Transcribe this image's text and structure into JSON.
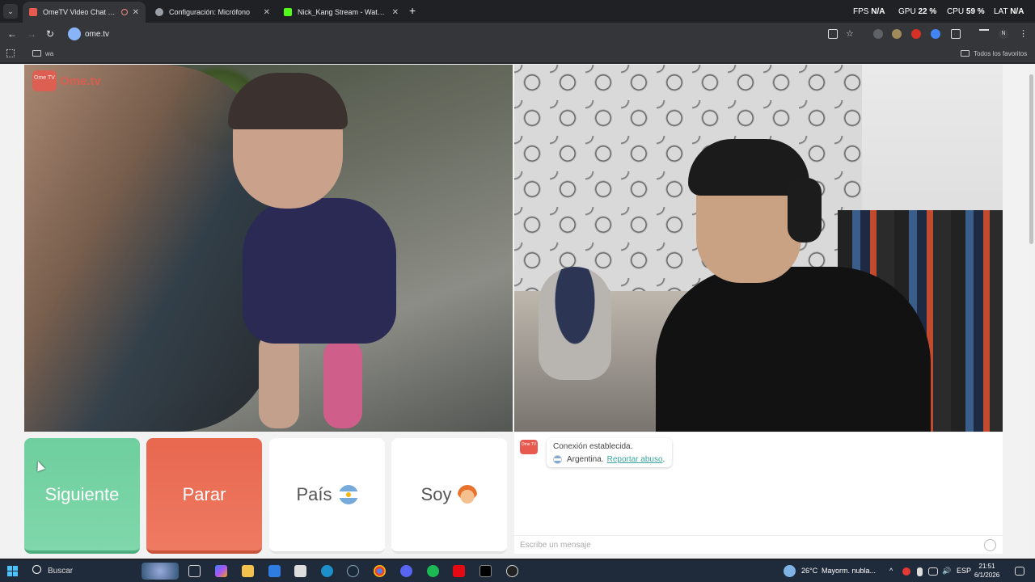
{
  "browser": {
    "tabs": [
      {
        "title": "OmeTV Video Chat — Ome",
        "active": true,
        "favicon_color": "#e85a4f"
      },
      {
        "title": "Configuración: Micrófono",
        "active": false,
        "favicon_color": "#9aa0a6"
      },
      {
        "title": "Nick_Kang Stream - Watch Live",
        "active": false,
        "favicon_color": "#53fc18"
      }
    ],
    "new_tab": "+",
    "perf": {
      "fps_label": "FPS",
      "fps_value": "N/A",
      "gpu_label": "GPU",
      "gpu_value": "22 %",
      "cpu_label": "CPU",
      "cpu_value": "59 %",
      "lat_label": "LAT",
      "lat_value": "N/A"
    },
    "url": "ome.tv",
    "bookmarks": {
      "folder": "wa",
      "all": "Todos los favoritos"
    }
  },
  "ometv": {
    "logo_box": "Ome TV",
    "logo_text": "Ome.tv",
    "buttons": {
      "next": "Siguiente",
      "stop": "Parar",
      "country": "País",
      "gender": "Soy"
    },
    "chat": {
      "logo": "Ome TV",
      "status": "Conexión establecida.",
      "country": "Argentina.",
      "report": "Reportar abuso",
      "report_suffix": ".",
      "placeholder": "Escribe un mensaje"
    }
  },
  "taskbar": {
    "search": "Buscar",
    "weather_temp": "26°C",
    "weather_desc": "Mayorm. nubla...",
    "lang": "ESP",
    "time": "21:51",
    "date": "6/1/2026"
  },
  "colors": {
    "next": "#6fcf9e",
    "stop": "#e8674f",
    "accent": "#3aa7a0",
    "brand": "#e85a4f"
  }
}
